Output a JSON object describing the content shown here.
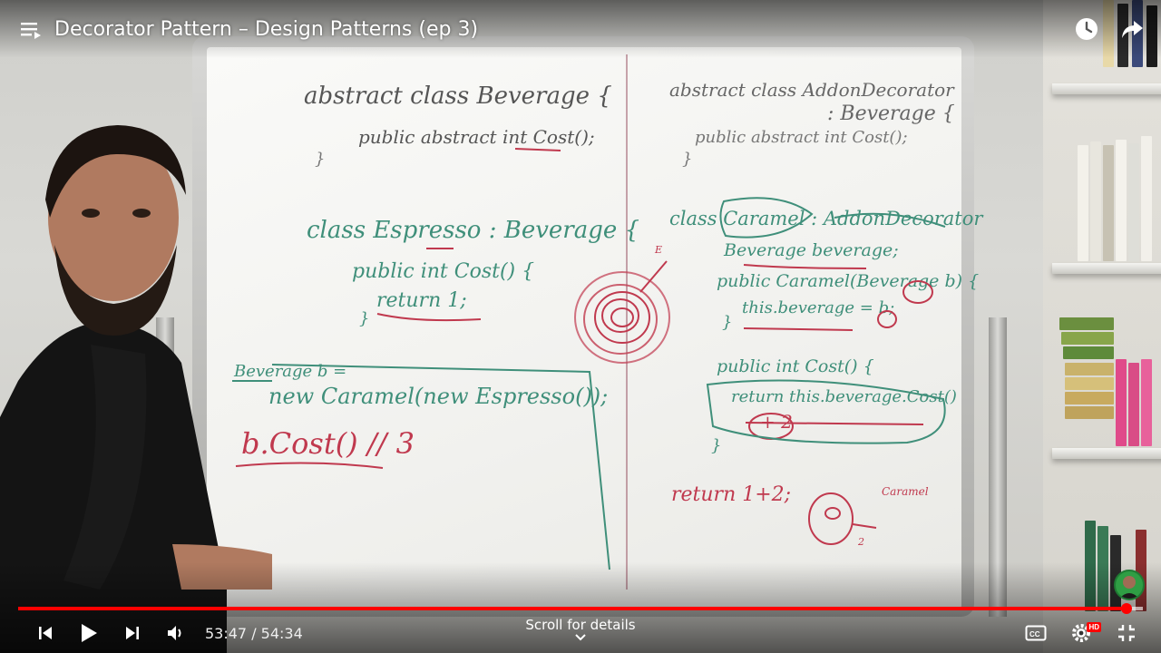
{
  "video": {
    "title": "Decorator Pattern – Design Patterns (ep 3)",
    "current_time": "53:47",
    "duration": "54:34",
    "time_separator": " / ",
    "progress_played": 0.9856,
    "progress_loaded": 1.0,
    "scroll_hint": "Scroll for details"
  },
  "whiteboard": {
    "left_lines": [
      "abstract class Beverage {",
      "public abstract int Cost();",
      "}",
      "class Espresso : Beverage {",
      "public int Cost() {",
      "return 1;",
      "}",
      "Beverage b =",
      "new Caramel(new Espresso());",
      "b.Cost() // 3"
    ],
    "right_lines": [
      "abstract class AddonDecorator",
      ": Beverage {",
      "public abstract int Cost();",
      "}",
      "class Caramel : AddonDecorator",
      "Beverage beverage;",
      "public Caramel(Beverage b) {",
      "this.beverage = b;",
      "}",
      "public int Cost() {",
      "return this.beverage.Cost()",
      "+ 2",
      "}",
      "return 1+2;",
      "Caramel",
      "E",
      "2"
    ]
  },
  "icons": {
    "playlist": "playlist-icon",
    "watch_later": "clock-icon",
    "share": "share-icon",
    "previous": "skip-previous-icon",
    "play": "play-icon",
    "next": "skip-next-icon",
    "volume": "volume-icon",
    "scroll": "chevron-down-icon",
    "captions": "captions-icon",
    "settings": "gear-icon",
    "fullscreen_exit": "fullscreen-exit-icon"
  },
  "badges": {
    "quality": "HD"
  },
  "colors": {
    "progress": "#ff0000",
    "marker_green": "#3f8f7a",
    "marker_red": "#c0394e"
  }
}
